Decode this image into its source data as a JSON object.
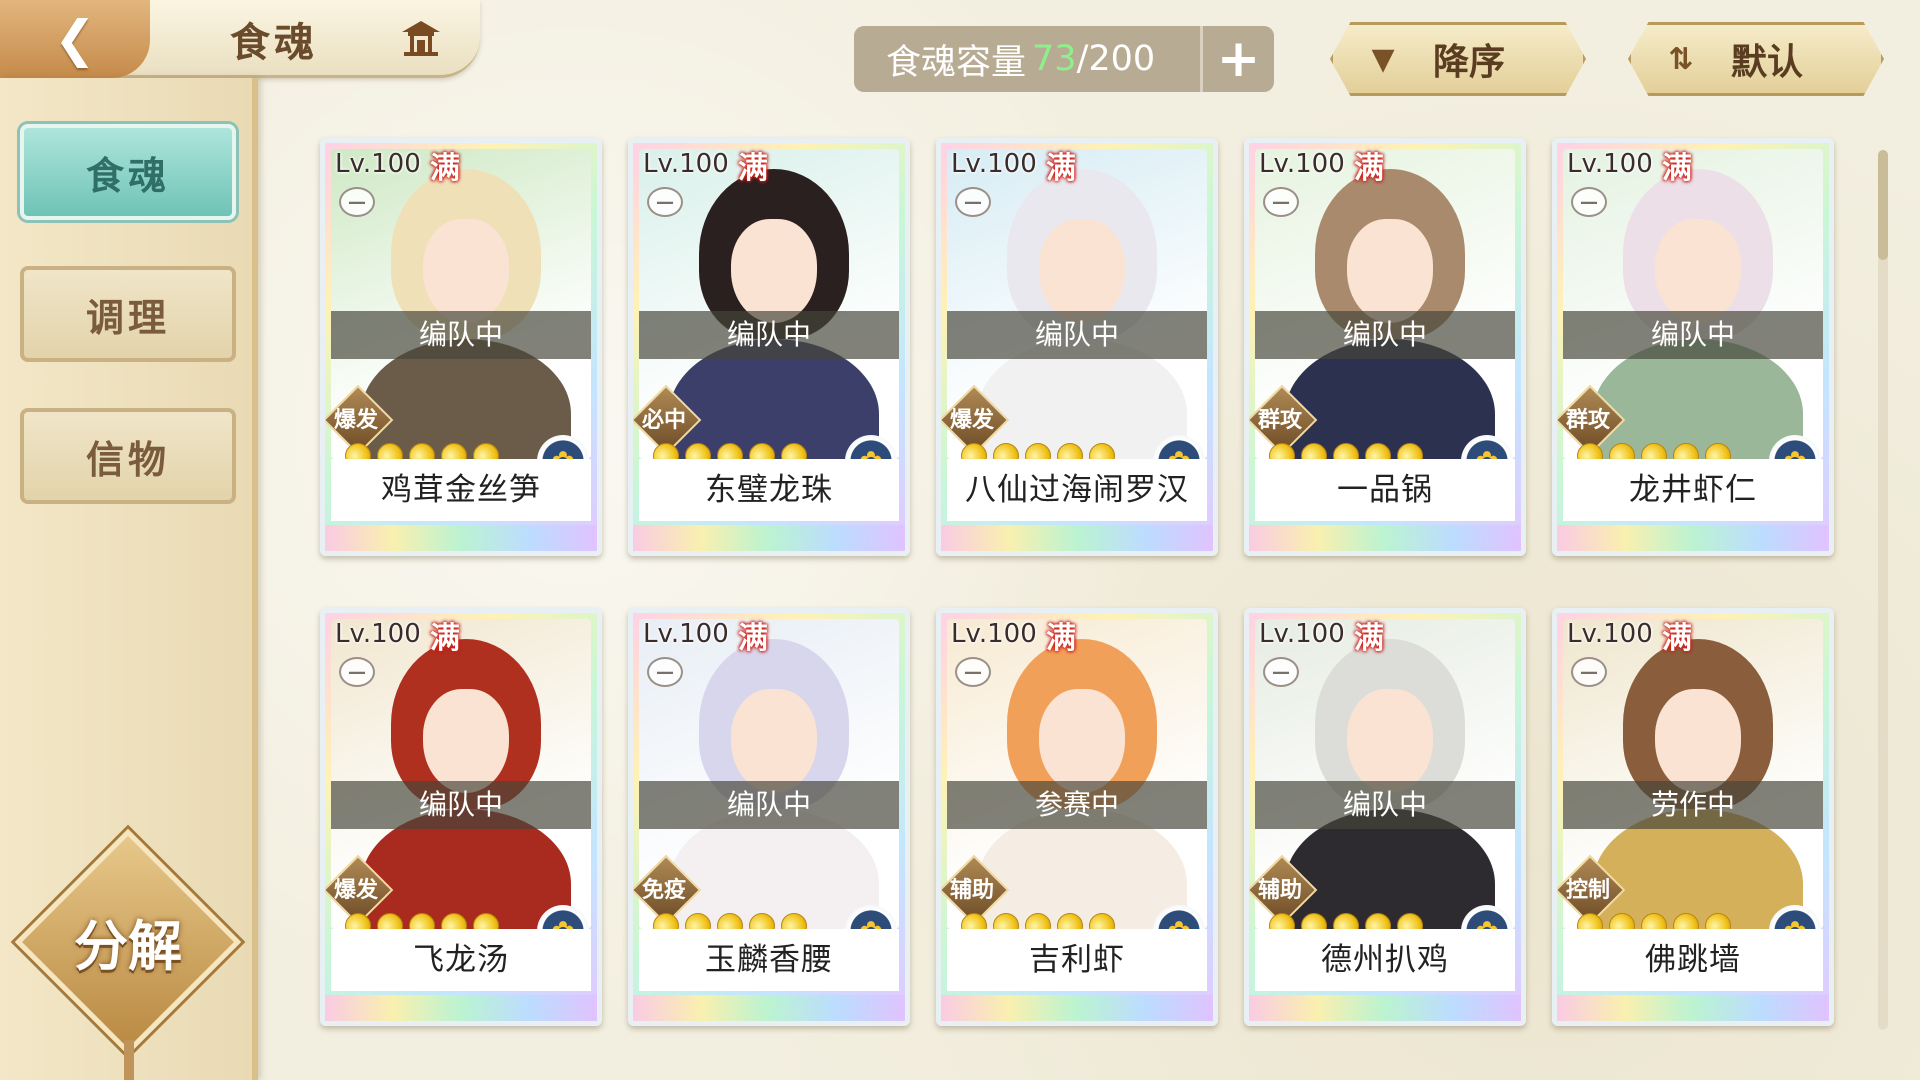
{
  "header": {
    "title": "食魂",
    "capacity_label": "食魂容量",
    "capacity_current": "73",
    "capacity_max": "/200",
    "capacity_add": "+",
    "sort_order_label": "降序",
    "sort_mode_label": "默认"
  },
  "sidebar": {
    "tabs": [
      {
        "label": "食魂",
        "active": true
      },
      {
        "label": "调理",
        "active": false
      },
      {
        "label": "信物",
        "active": false
      }
    ],
    "decompose_label": "分解"
  },
  "cards": [
    {
      "level": "Lv.100",
      "full": "满",
      "status": "编队中",
      "role": "爆发",
      "name": "鸡茸金丝笋",
      "hair": "#efe0b8",
      "body": "#6b5c4a",
      "bg": "#cfe9c5"
    },
    {
      "level": "Lv.100",
      "full": "满",
      "status": "编队中",
      "role": "必中",
      "name": "东璧龙珠",
      "hair": "#2b2020",
      "body": "#3c3f6a",
      "bg": "#d9f0ea"
    },
    {
      "level": "Lv.100",
      "full": "满",
      "status": "编队中",
      "role": "爆发",
      "name": "八仙过海闹罗汉",
      "hair": "#e8e8ee",
      "body": "#f1f1f1",
      "bg": "#d6ecf4"
    },
    {
      "level": "Lv.100",
      "full": "满",
      "status": "编队中",
      "role": "群攻",
      "name": "一品锅",
      "hair": "#a98a6c",
      "body": "#2d3150",
      "bg": "#e6f3df"
    },
    {
      "level": "Lv.100",
      "full": "满",
      "status": "编队中",
      "role": "群攻",
      "name": "龙井虾仁",
      "hair": "#ecdfe7",
      "body": "#9ab79a",
      "bg": "#e4f2e1"
    },
    {
      "level": "Lv.100",
      "full": "满",
      "status": "编队中",
      "role": "爆发",
      "name": "飞龙汤",
      "hair": "#b0301f",
      "body": "#a92a1f",
      "bg": "#f1e7cf"
    },
    {
      "level": "Lv.100",
      "full": "满",
      "status": "编队中",
      "role": "免疫",
      "name": "玉麟香腰",
      "hair": "#d8d6ec",
      "body": "#f4f0f2",
      "bg": "#e8eef5"
    },
    {
      "level": "Lv.100",
      "full": "满",
      "status": "参赛中",
      "role": "辅助",
      "name": "吉利虾",
      "hair": "#f1a05a",
      "body": "#f5ede4",
      "bg": "#f7ead2"
    },
    {
      "level": "Lv.100",
      "full": "满",
      "status": "编队中",
      "role": "辅助",
      "name": "德州扒鸡",
      "hair": "#dcdcd8",
      "body": "#2d2b30",
      "bg": "#e6ece2"
    },
    {
      "level": "Lv.100",
      "full": "满",
      "status": "劳作中",
      "role": "控制",
      "name": "佛跳墙",
      "hair": "#8a5e3c",
      "body": "#d5b05a",
      "bg": "#efe6cd"
    }
  ],
  "colors": {
    "accent_teal": "#6fc3b6",
    "gold": "#c58b4a",
    "capacity_green": "#8ef08a"
  },
  "icons": {
    "back": "back-arrow-icon",
    "house": "pavilion-icon",
    "sort_order": "triangle-down-icon",
    "sort_mode": "swap-icon",
    "bowl": "bowl-icon",
    "rarity": "flower-icon",
    "stars": "flame-star-icon"
  }
}
